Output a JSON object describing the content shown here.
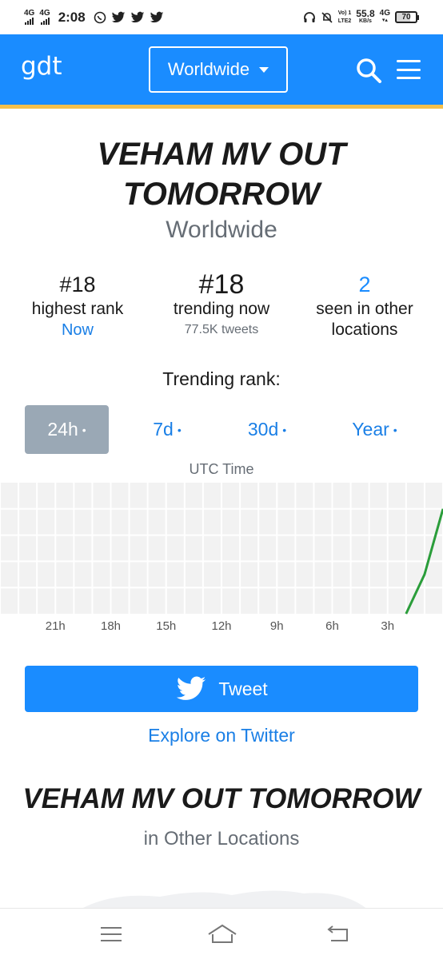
{
  "status_bar": {
    "net1": "4G",
    "net2": "4G",
    "time": "2:08",
    "volte": "Vo) 1",
    "lte": "LTE2",
    "speed": "55.8",
    "speed_unit": "KB/s",
    "net3": "4G",
    "battery": "70"
  },
  "header": {
    "logo": "gdt",
    "location": "Worldwide",
    "colors": {
      "bar": "#1a8cff",
      "stripe": "#f5c04a"
    }
  },
  "trend": {
    "title": "VEHAM MV OUT TOMORROW",
    "location": "Worldwide"
  },
  "stats": {
    "highest": {
      "value": "#18",
      "label": "highest rank",
      "sub": "Now"
    },
    "now": {
      "value": "#18",
      "label": "trending now",
      "sub": "77.5K tweets"
    },
    "other": {
      "value": "2",
      "label": "seen in other locations"
    }
  },
  "rank_heading": "Trending rank:",
  "tabs": [
    {
      "label": "24h",
      "dot": "•",
      "active": true
    },
    {
      "label": "7d",
      "dot": "•",
      "active": false
    },
    {
      "label": "30d",
      "dot": "•",
      "active": false
    },
    {
      "label": "Year",
      "dot": "•",
      "active": false
    }
  ],
  "chart_data": {
    "type": "line",
    "xlabel": "UTC Time",
    "x_tick_labels": [
      "21h",
      "18h",
      "15h",
      "12h",
      "9h",
      "6h",
      "3h"
    ],
    "x_hours_ago": [
      21,
      18,
      15,
      12,
      9,
      6,
      3
    ],
    "xlim_hours_ago": [
      24,
      0
    ],
    "series": [
      {
        "hours_ago": [
          2,
          1,
          0
        ],
        "rank_level": [
          0,
          0.3,
          0.8
        ]
      }
    ],
    "grid": true,
    "line_color": "#2a9d3a"
  },
  "tweet_button": "Tweet",
  "explore_link": "Explore on Twitter",
  "other_section": {
    "title": "VEHAM MV OUT TOMORROW",
    "subtitle": "in Other Locations"
  }
}
